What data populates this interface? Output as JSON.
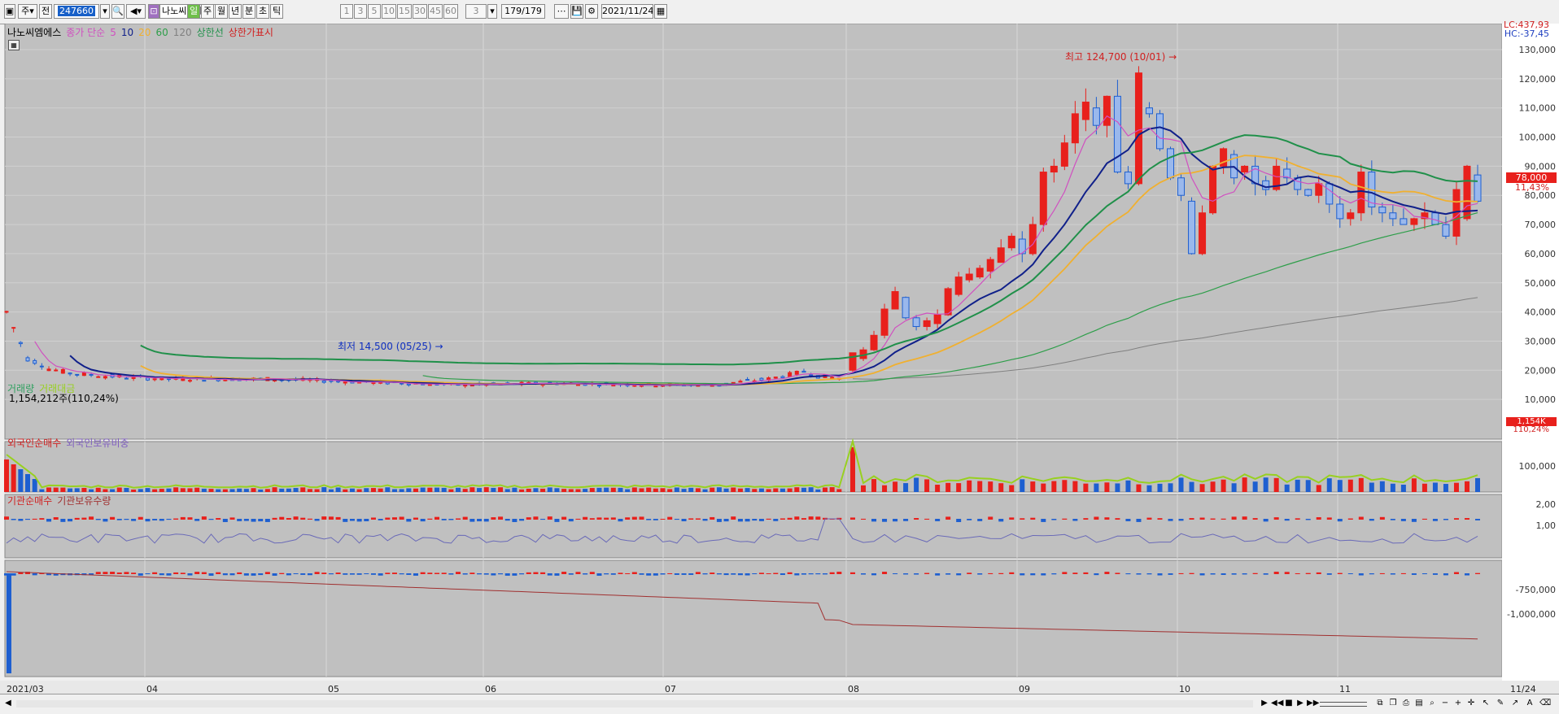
{
  "toolbar": {
    "ju": "주",
    "jeon": "전",
    "code": "247660",
    "name": "나노씨엠에",
    "periods": [
      "일",
      "주",
      "월",
      "년",
      "분",
      "초",
      "틱"
    ],
    "active_period": "일",
    "minutes": [
      "1",
      "3",
      "5",
      "10",
      "15",
      "30",
      "45",
      "60"
    ],
    "custom_min": "3",
    "count": "179/179",
    "date": "2021/11/24"
  },
  "price_legend": {
    "stock_name": "나노씨엠에스",
    "ma_label": "종가 단순",
    "ma5": "5",
    "ma10": "10",
    "ma20": "20",
    "ma60": "60",
    "ma120": "120",
    "upper_limit_line": "상한선",
    "upper_limit_show": "상한가표시"
  },
  "axis_info": {
    "lc": "LC:437,93",
    "hc": "HC:-37,45",
    "price_tag": "78,000",
    "change_pct": "11,43%"
  },
  "annotations": {
    "high": "최고 124,700 (10/01)",
    "low": "최저 14,500 (05/25)"
  },
  "price_axis": [
    "130,000",
    "120,000",
    "110,000",
    "100,000",
    "90,000",
    "80,000",
    "70,000",
    "60,000",
    "50,000",
    "40,000",
    "30,000",
    "20,000",
    "10,000"
  ],
  "volume_legend": {
    "vol": "거래량",
    "amount": "거래대금",
    "value": "1,154,212주(110,24%)"
  },
  "volume_axis": [
    "100,000"
  ],
  "volume_tag": {
    "val": "1,154K",
    "pct": "110,24%"
  },
  "foreign_legend": {
    "net": "외국인순매수",
    "ratio": "외국인보유비중"
  },
  "foreign_axis": [
    "2,00",
    "1,00"
  ],
  "inst_legend": {
    "net": "기관순매수",
    "hold": "기관보유수량"
  },
  "inst_axis": [
    "-750,000",
    "-1,000,000"
  ],
  "x_axis": [
    "2021/03",
    "04",
    "05",
    "06",
    "07",
    "08",
    "09",
    "10",
    "11",
    "11/24"
  ],
  "colors": {
    "up": "#e8201c",
    "down": "#1e5fd0",
    "bg": "#c0c0c0",
    "ma5": "#d050c0",
    "ma10": "#10208a",
    "ma20": "#f0b030",
    "ma60": "#2e9e4a",
    "ma120": "#808080",
    "upper": "#20904a",
    "vol_line": "#98d020"
  },
  "chart_data": {
    "type": "candlestick",
    "x": [
      "03",
      "04",
      "05",
      "06",
      "07",
      "08",
      "09",
      "10",
      "11",
      "11/24"
    ],
    "close": [
      16000,
      17000,
      15000,
      15000,
      15000,
      20000,
      60000,
      100000,
      72000,
      78000
    ],
    "high": 124700,
    "low": 14500,
    "ylim": [
      0,
      130000
    ]
  }
}
